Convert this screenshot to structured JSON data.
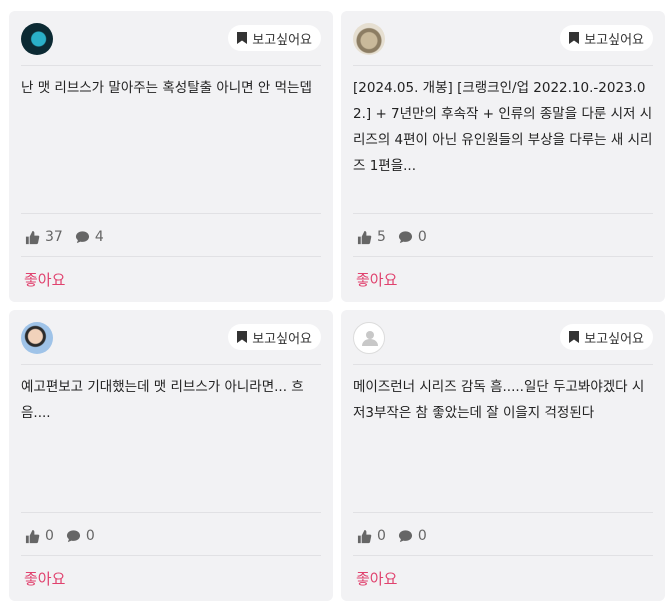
{
  "cards": [
    {
      "wish_label": "보고싶어요",
      "text": "난 맷 리브스가 말아주는 혹성탈출 아니면 안 먹는뎁",
      "likes": "37",
      "comments": "4",
      "like_label": "좋아요"
    },
    {
      "wish_label": "보고싶어요",
      "text": "[2024.05. 개봉] [크랭크인/업 2022.10.-2023.02.] + 7년만의 후속작 + 인류의 종말을 다룬 시저 시리즈의 4편이 아닌 유인원들의 부상을 다루는 새 시리즈 1편을...",
      "likes": "5",
      "comments": "0",
      "like_label": "좋아요"
    },
    {
      "wish_label": "보고싶어요",
      "text": "예고편보고 기대했는데 맷 리브스가 아니라면... 흐음....",
      "likes": "0",
      "comments": "0",
      "like_label": "좋아요"
    },
    {
      "wish_label": "보고싶어요",
      "text": "메이즈런너 시리즈 감독 흠.....일단 두고봐야겠다 시저3부작은 참 좋았는데 잘 이을지 걱정된다",
      "likes": "0",
      "comments": "0",
      "like_label": "좋아요"
    }
  ],
  "colors": {
    "card_bg": "#f2f2f4",
    "accent": "#e0426e"
  },
  "icons": {
    "wish": "bookmark-icon",
    "like": "thumbs-up-icon",
    "comment": "comment-icon"
  }
}
